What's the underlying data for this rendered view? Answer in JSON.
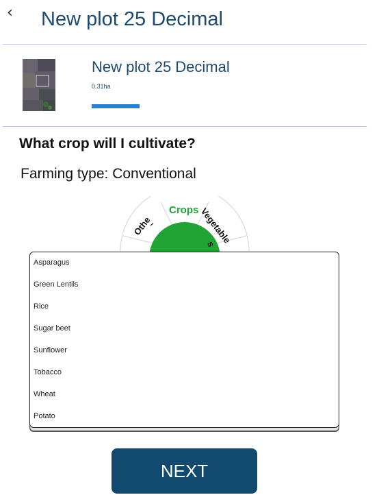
{
  "header": {
    "back_icon": "chevron-left-icon",
    "title": "New plot 25 Decimal"
  },
  "plot": {
    "name": "New plot 25 Decimal",
    "area": "0.31ha",
    "thumbnail": "satellite-plot-thumbnail"
  },
  "question": "What crop will I cultivate?",
  "farming_type_label": "Farming type: Conventional",
  "wheel": {
    "segments": [
      "Othe",
      "Crops",
      "Vegetable",
      "s"
    ],
    "active_segment": "Crops",
    "active_color": "#21a336"
  },
  "crop_options": [
    "Asparagus",
    "Green Lentils",
    "Rice",
    "Sugar beet",
    "Sunflower",
    "Tobacco",
    "Wheat",
    "Potato"
  ],
  "next_label": "NEXT",
  "colors": {
    "title": "#1d4a6e",
    "button": "#124a6f",
    "progress": "#2f7fcf",
    "divider": "#b8c4e2"
  }
}
